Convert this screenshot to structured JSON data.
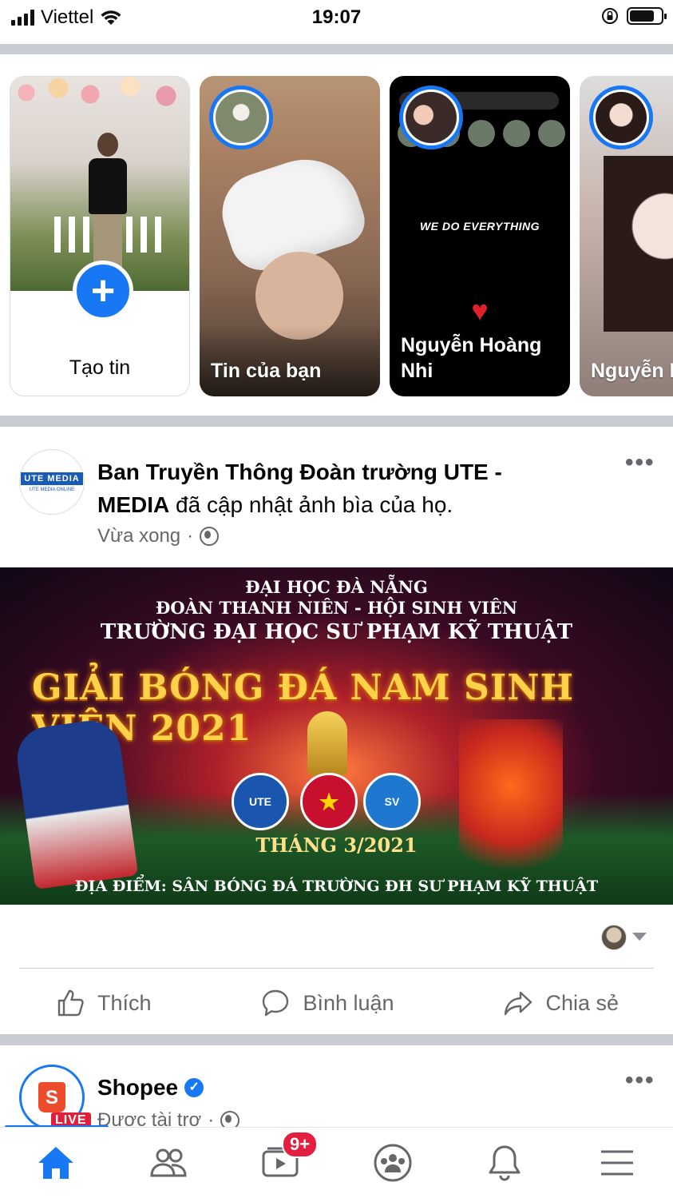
{
  "status_bar": {
    "carrier": "Viettel",
    "time": "19:07"
  },
  "stories": {
    "create_label": "Tạo tin",
    "items": [
      {
        "name": "Tin của bạn"
      },
      {
        "name": "Nguyễn Hoàng Nhi",
        "overlay_text": "WE DO EVERYTHING"
      },
      {
        "name": "Nguyễn Ngọc Tú"
      }
    ]
  },
  "post": {
    "author": "Ban Truyền Thông Đoàn trường UTE - MEDIA",
    "action": " đã cập nhật ảnh bìa của họ.",
    "time": "Vừa xong",
    "avatar_logo_text": "UTE MEDIA",
    "avatar_sub_text": "UTE MEDIA ONLINE",
    "cover": {
      "line1": "ĐẠI HỌC ĐÀ NẴNG",
      "line2": "ĐOÀN THANH NIÊN - HỘI SINH VIÊN",
      "line3": "TRƯỜNG ĐẠI HỌC SƯ PHẠM KỸ THUẬT",
      "title": "GIẢI BÓNG ĐÁ NAM SINH VIÊN 2021",
      "month": "THÁNG 3/2021",
      "venue": "ĐỊA ĐIỂM: SÂN BÓNG ĐÁ TRƯỜNG ĐH SƯ PHẠM KỸ THUẬT",
      "logo1": "UTE",
      "logo2": "★",
      "logo3": "SV"
    },
    "actions": {
      "like": "Thích",
      "comment": "Bình luận",
      "share": "Chia sẻ"
    }
  },
  "sponsored_post": {
    "name": "Shopee",
    "label": "Được tài trợ",
    "bag_letter": "S",
    "live_tag": "LIVE"
  },
  "bottom_nav": {
    "video_badge": "9+"
  },
  "colors": {
    "accent": "#1877f2",
    "badge": "#e41e3f",
    "muted_text": "#65676b"
  }
}
